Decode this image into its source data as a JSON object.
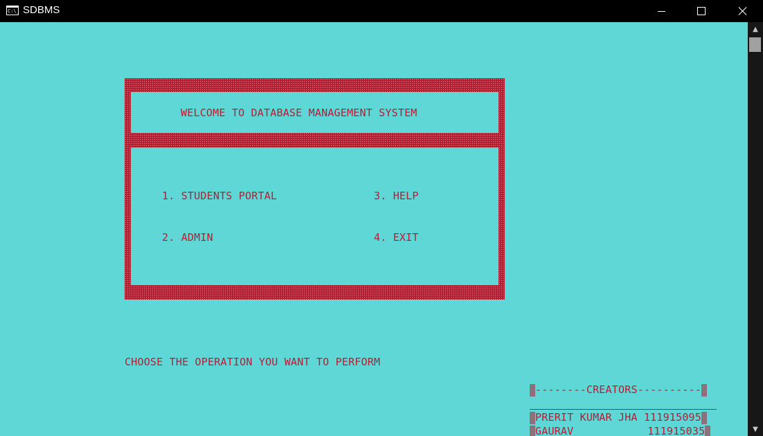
{
  "window": {
    "title": "SDBMS",
    "icon_label": "C:\\_"
  },
  "console": {
    "header": "WELCOME TO DATABASE MANAGEMENT SYSTEM",
    "menu": {
      "option1": "1. STUDENTS PORTAL",
      "option2": "2. ADMIN",
      "option3": "3. HELP",
      "option4": "4. EXIT"
    },
    "prompt": "CHOOSE THE OPERATION YOU WANT TO PERFORM",
    "creators": {
      "heading": "--------CREATORS----------",
      "rows": [
        {
          "name": "PRERIT KUMAR JHA",
          "id": "111915095"
        },
        {
          "name": "GAURAV",
          "id": "111915035"
        }
      ]
    }
  },
  "colors": {
    "background": "#5fd7d7",
    "text": "#b22035",
    "titlebar": "#000000"
  }
}
